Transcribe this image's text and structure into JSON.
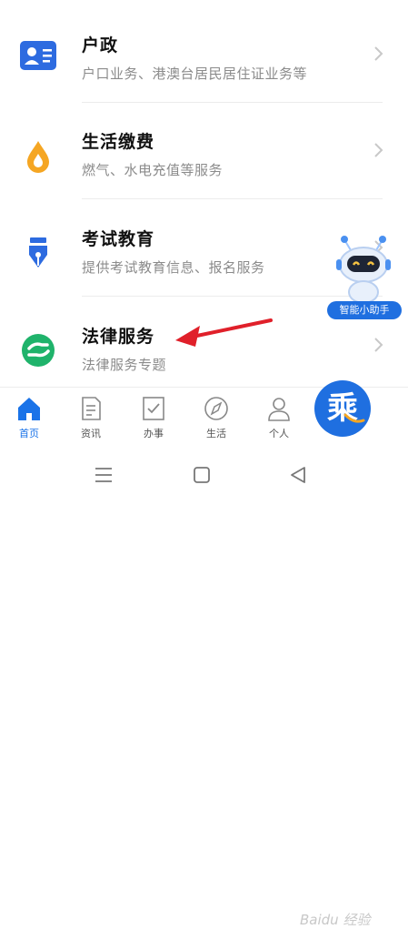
{
  "services": [
    {
      "title": "户政",
      "subtitle": "户口业务、港澳台居民居住证业务等",
      "icon": "id-card-icon",
      "color": "#2d6be0"
    },
    {
      "title": "生活缴费",
      "subtitle": "燃气、水电充值等服务",
      "icon": "water-drop-icon",
      "color": "#f5a623"
    },
    {
      "title": "考试教育",
      "subtitle": "提供考试教育信息、报名服务",
      "icon": "pen-nib-icon",
      "color": "#2d6be0"
    },
    {
      "title": "法律服务",
      "subtitle": "法律服务专题",
      "icon": "handshake-icon",
      "color": "#1fb36b"
    }
  ],
  "assistant": {
    "label": "智能小助手"
  },
  "tabs": [
    {
      "label": "首页",
      "icon": "home-icon",
      "active": true
    },
    {
      "label": "资讯",
      "icon": "news-icon",
      "active": false
    },
    {
      "label": "办事",
      "icon": "checkbox-icon",
      "active": false
    },
    {
      "label": "生活",
      "icon": "compass-icon",
      "active": false
    },
    {
      "label": "个人",
      "icon": "person-icon",
      "active": false
    }
  ],
  "fab": {
    "glyph": "乘"
  },
  "watermark": "Baidu 经验",
  "colors": {
    "accent": "#1f6fe0",
    "arrow": "#e0202a"
  }
}
